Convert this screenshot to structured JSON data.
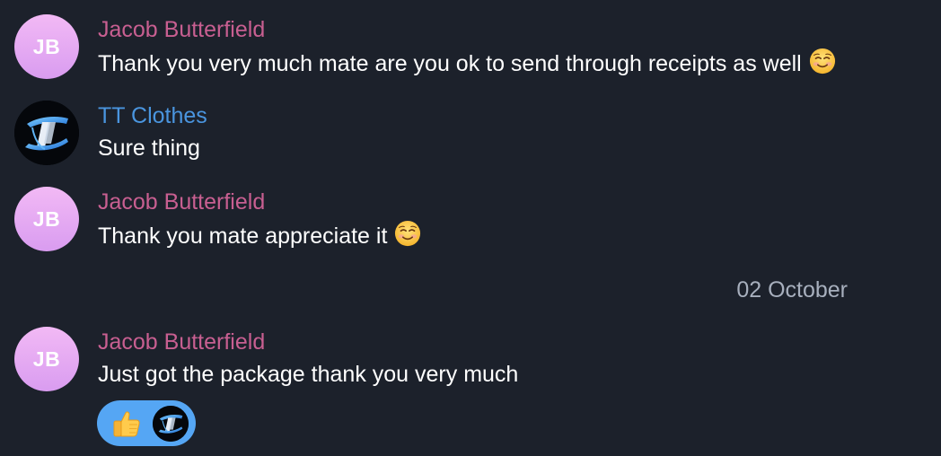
{
  "colors": {
    "background": "#1c212b",
    "jacob_name": "#c85f91",
    "tt_name": "#4a95df",
    "reaction_bg": "#55a6f4",
    "date_text": "#a7afbd"
  },
  "messages": [
    {
      "sender": "Jacob Butterfield",
      "initials": "JB",
      "text": "Thank you very much mate are you ok to send through receipts as well",
      "emoji": "smiling-face-icon"
    },
    {
      "sender": "TT Clothes",
      "initials": "",
      "text": "Sure thing",
      "avatar_icon": "tt-logo-icon"
    },
    {
      "sender": "Jacob Butterfield",
      "initials": "JB",
      "text": "Thank you mate appreciate it",
      "emoji": "smiling-face-icon"
    },
    {
      "sender": "Jacob Butterfield",
      "initials": "JB",
      "text": "Just got the package thank you very much"
    }
  ],
  "date_separator": "02 October",
  "reaction": {
    "emoji": "thumbs-up-icon",
    "reactor_avatar": "tt-logo-icon"
  }
}
